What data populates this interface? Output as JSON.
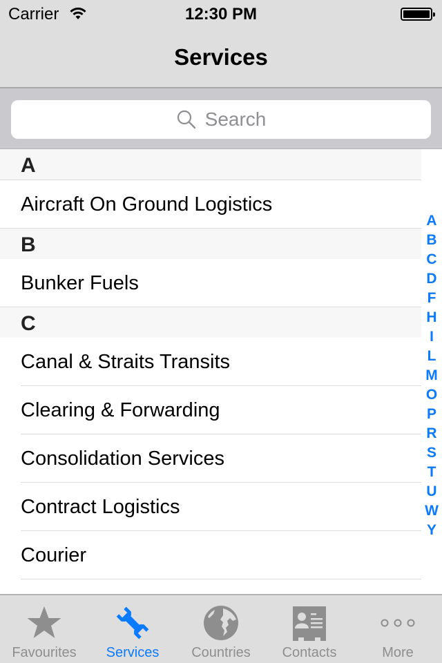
{
  "status_bar": {
    "carrier": "Carrier",
    "time": "12:30 PM",
    "wifi_icon": "wifi-icon",
    "battery_icon": "battery-full-icon"
  },
  "nav": {
    "title": "Services"
  },
  "search": {
    "placeholder": "Search",
    "icon": "search-icon"
  },
  "sections": [
    {
      "header": "A",
      "items": [
        "Aircraft On Ground Logistics"
      ]
    },
    {
      "header": "B",
      "items": [
        "Bunker Fuels"
      ]
    },
    {
      "header": "C",
      "items": [
        "Canal & Straits Transits",
        "Clearing & Forwarding",
        "Consolidation Services",
        "Contract Logistics",
        "Courier"
      ]
    }
  ],
  "index": [
    "A",
    "B",
    "C",
    "D",
    "F",
    "H",
    "I",
    "L",
    "M",
    "O",
    "P",
    "R",
    "S",
    "T",
    "U",
    "W",
    "Y"
  ],
  "tabs": [
    {
      "label": "Favourites",
      "icon": "star-icon",
      "active": false
    },
    {
      "label": "Services",
      "icon": "wrench-icon",
      "active": true
    },
    {
      "label": "Countries",
      "icon": "globe-icon",
      "active": false
    },
    {
      "label": "Contacts",
      "icon": "contact-card-icon",
      "active": false
    },
    {
      "label": "More",
      "icon": "more-dots-icon",
      "active": false
    }
  ],
  "colors": {
    "accent": "#0a7aff",
    "inactive_tab": "#8e8e8e",
    "bar_background": "#dedede",
    "search_background": "#c9c9ce",
    "section_header_background": "#f7f7f7"
  }
}
